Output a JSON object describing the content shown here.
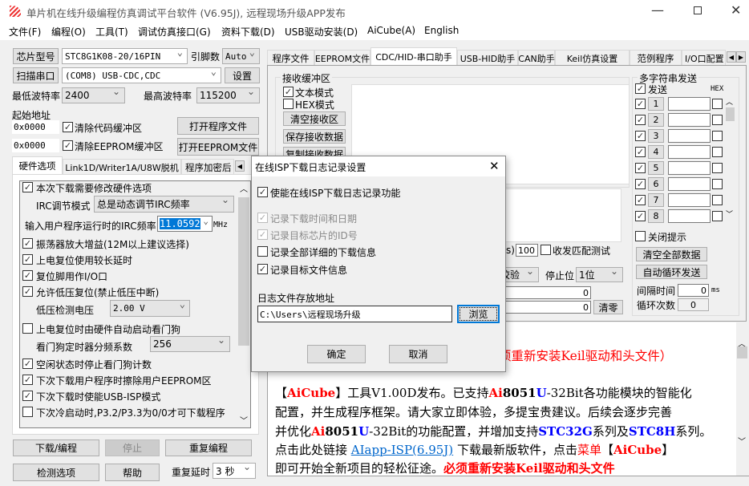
{
  "window": {
    "title": "单片机在线升级编程仿真调试平台软件 (V6.95J), 远程现场升级APP发布",
    "controls": [
      "minimize",
      "maximize",
      "close"
    ]
  },
  "menu": [
    "文件(F)",
    "编程(O)",
    "工具(T)",
    "调试仿真接口(G)",
    "资料下载(D)",
    "USB驱动安装(D)",
    "AiCube(A)",
    "English"
  ],
  "left": {
    "chip_button": "芯片型号",
    "chip_value": "STC8G1K08-20/16PIN",
    "pins_label": "引脚数",
    "pins_value": "Auto",
    "scan_button": "扫描串口",
    "port_value": "(COM8) USB-CDC,CDC",
    "settings_button": "设置",
    "min_baud_label": "最低波特率",
    "min_baud": "2400",
    "max_baud_label": "最高波特率",
    "max_baud": "115200",
    "start_addr_label": "起始地址",
    "addr1": "0x0000",
    "clear_code": "清除代码缓冲区",
    "open_program": "打开程序文件",
    "addr2": "0x0000",
    "clear_eeprom": "清除EEPROM缓冲区",
    "open_eeprom": "打开EEPROM文件",
    "tabs": [
      "硬件选项",
      "Link1D/Writer1A/U8W脱机",
      "程序加密后"
    ],
    "options": {
      "o1": "本次下载需要修改硬件选项",
      "irc_mode_label": "IRC调节模式",
      "irc_mode": "总是动态调节IRC频率",
      "irc_freq_label": "输入用户程序运行时的IRC频率",
      "irc_freq": "11.0592",
      "mhz": "MHz",
      "o2": "振荡器放大增益(12M以上建议选择)",
      "o3": "上电复位使用较长延时",
      "o4": "复位脚用作I/O口",
      "o5": "允许低压复位(禁止低压中断)",
      "lvd_label": "低压检测电压",
      "lvd": "2.00 V",
      "o6": "上电复位时由硬件自动启动看门狗",
      "wdt_label": "看门狗定时器分频系数",
      "wdt": "256",
      "o7": "空闲状态时停止看门狗计数",
      "o8": "下次下载用户程序时擦除用户EEPROM区",
      "o9": "下次下载时使能USB-ISP模式",
      "o10": "下次冷启动时,P3.2/P3.3为0/0才可下载程序"
    },
    "download": "下载/编程",
    "stop": "停止",
    "repeat": "重复编程",
    "check": "检测选项",
    "help": "帮助",
    "delay_label": "重复延时",
    "delay": "3 秒"
  },
  "right": {
    "tabs": [
      "程序文件",
      "EEPROM文件",
      "CDC/HID-串口助手",
      "USB-HID助手",
      "CAN助手",
      "Keil仿真设置",
      "范例程序",
      "I/O口配置"
    ],
    "recv_group": "接收缓冲区",
    "text_mode": "文本模式",
    "hex_mode": "HEX模式",
    "clear_recv": "清空接收区",
    "save_recv": "保存接收数据",
    "copy_recv": "复制接收数据",
    "s_suffix": "s)",
    "interval": "100",
    "match_test": "收发匹配测试",
    "parity": "校验",
    "stopbit_label": "停止位",
    "stopbit": "1位",
    "count1": "0",
    "count2": "0",
    "clear_count": "清零",
    "multi_group": "多字符串发送",
    "send": "发送",
    "hex": "HEX",
    "rows": [
      "1",
      "2",
      "3",
      "4",
      "5",
      "6",
      "7",
      "8"
    ],
    "close_tip": "关闭提示",
    "clear_all": "清空全部数据",
    "auto_loop": "自动循环发送",
    "gap_label": "间隔时间",
    "gap": "0",
    "ms": "ms",
    "loops_label": "循环次数",
    "loops": "0"
  },
  "news": {
    "l0": "须重新安装Keil驱动和头文件）",
    "l1": [
      "【",
      "AiCube",
      "】工具V1.00D发布。已支持",
      "Ai",
      "8051",
      "U",
      "-32Bit各功能模块的智能化"
    ],
    "l2": "配置，并生成程序框架。请大家立即体验，多提宝贵建议。后续会逐步完善",
    "l3": [
      "并优化",
      "Ai",
      "8051",
      "U",
      "-32Bit的功能配置，并增加支持",
      "STC32G",
      "系列及",
      "STC8H",
      "系列。"
    ],
    "l4": [
      "点击此处链接 ",
      "AIapp-ISP(6.95J)",
      " 下载最新版软件，点击",
      "菜单",
      "【",
      "AiCube",
      "】"
    ],
    "l5": [
      "即可开始全新项目的轻松征途。",
      "必须重新安装Keil驱动和头文件"
    ]
  },
  "dialog": {
    "title": "在线ISP下载日志记录设置",
    "enable": "使能在线ISP下载日志记录功能",
    "rec_time": "记录下载时间和日期",
    "rec_id": "记录目标芯片的ID号",
    "rec_detail": "记录全部详细的下载信息",
    "rec_file": "记录目标文件信息",
    "path_label": "日志文件存放地址",
    "path": "C:\\Users\\远程现场升级",
    "browse": "浏览",
    "ok": "确定",
    "cancel": "取消"
  }
}
